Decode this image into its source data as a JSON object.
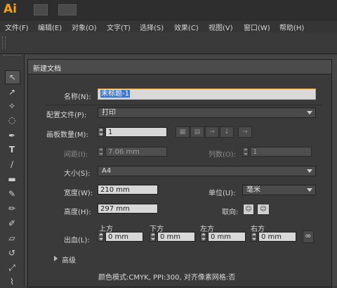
{
  "app": {
    "logo": "Ai"
  },
  "menubar": {
    "items": [
      "文件(F)",
      "编辑(E)",
      "对象(O)",
      "文字(T)",
      "选择(S)",
      "效果(C)",
      "视图(V)",
      "窗口(W)",
      "帮助(H)"
    ]
  },
  "dialog": {
    "title": "新建文档",
    "name_label": "名称(N):",
    "name_value": "未标题-1",
    "profile_label": "配置文件(P):",
    "profile_value": "打印",
    "artboards_label": "画板数量(M):",
    "artboards_value": "1",
    "spacing_label": "间距(I):",
    "spacing_value": "7.06 mm",
    "columns_label": "列数(O):",
    "columns_value": "1",
    "size_label": "大小(S):",
    "size_value": "A4",
    "width_label": "宽度(W):",
    "width_value": "210 mm",
    "units_label": "单位(U):",
    "units_value": "毫米",
    "height_label": "高度(H):",
    "height_value": "297 mm",
    "orientation_label": "取向:",
    "bleed_label": "出血(L):",
    "bleed_top_label": "上方",
    "bleed_bottom_label": "下方",
    "bleed_left_label": "左方",
    "bleed_right_label": "右方",
    "bleed_top": "0 mm",
    "bleed_bottom": "0 mm",
    "bleed_left": "0 mm",
    "bleed_right": "0 mm",
    "advanced_label": "高级",
    "summary": "颜色模式:CMYK, PPI:300, 对齐像素网格:否"
  },
  "colors": {
    "accent": "#f3a01f",
    "selection": "#3f78c9"
  }
}
